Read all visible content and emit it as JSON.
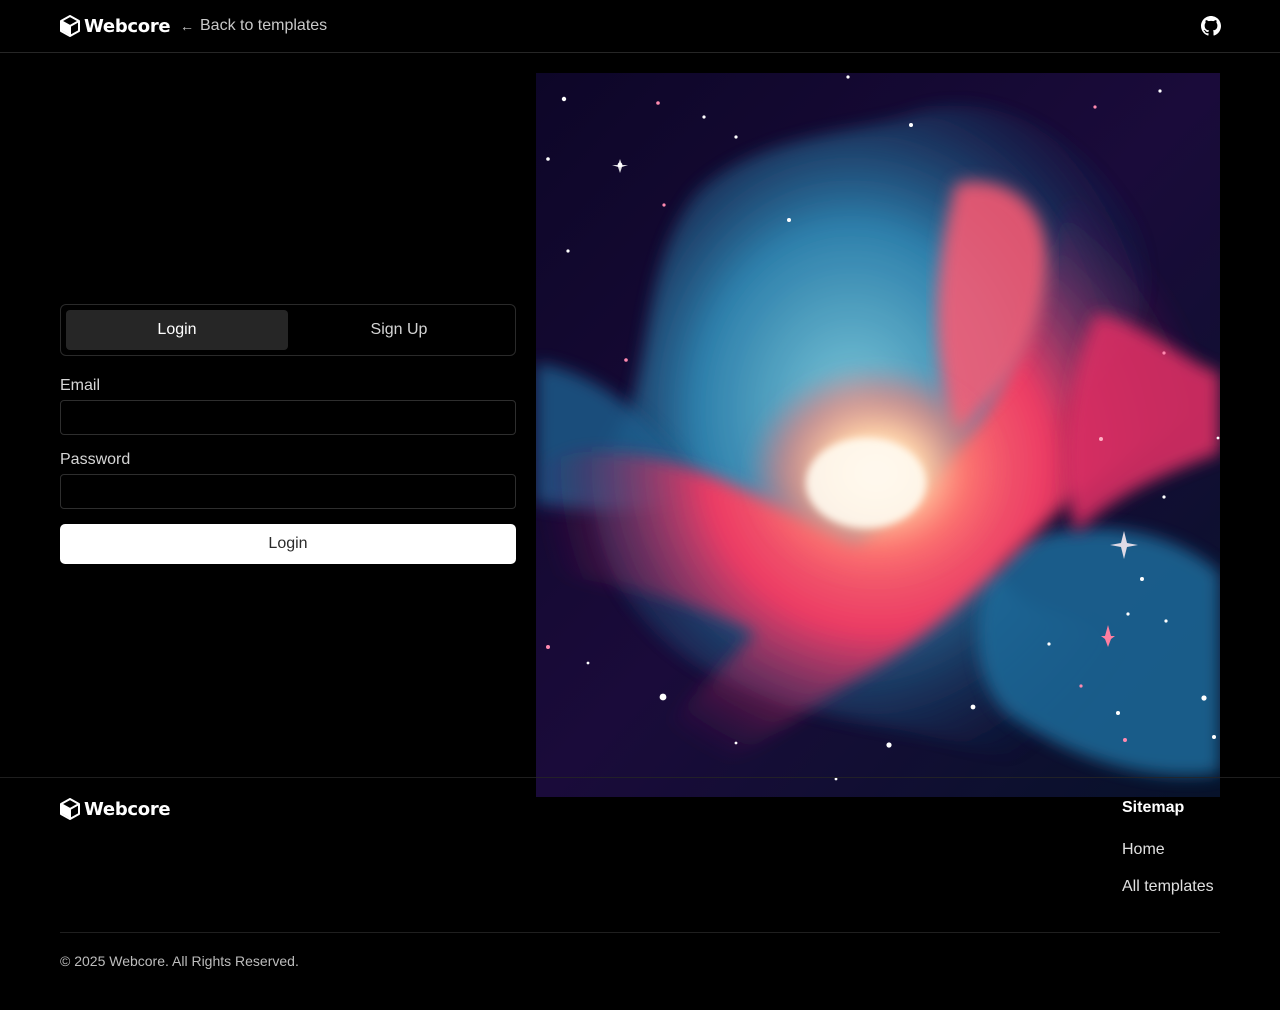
{
  "brand": {
    "name": "Webcore"
  },
  "header": {
    "back_label": "Back to templates"
  },
  "auth": {
    "tabs": [
      {
        "label": "Login",
        "active": true
      },
      {
        "label": "Sign Up",
        "active": false
      }
    ],
    "email_label": "Email",
    "email_value": "",
    "password_label": "Password",
    "password_value": "",
    "submit_label": "Login"
  },
  "footer": {
    "sitemap_title": "Sitemap",
    "links": [
      "Home",
      "All templates"
    ],
    "copyright": "© 2025 Webcore. All Rights Reserved."
  },
  "colors": {
    "background": "#000000",
    "border": "#262626",
    "active_tab": "#262626",
    "button": "#ffffff",
    "hero_magenta": "#e8305f",
    "hero_teal": "#1f6fa0",
    "hero_glow": "#fff3e0"
  },
  "icons": {
    "logo": "cube-logo-icon",
    "back": "arrow-left-icon",
    "github": "github-icon"
  }
}
